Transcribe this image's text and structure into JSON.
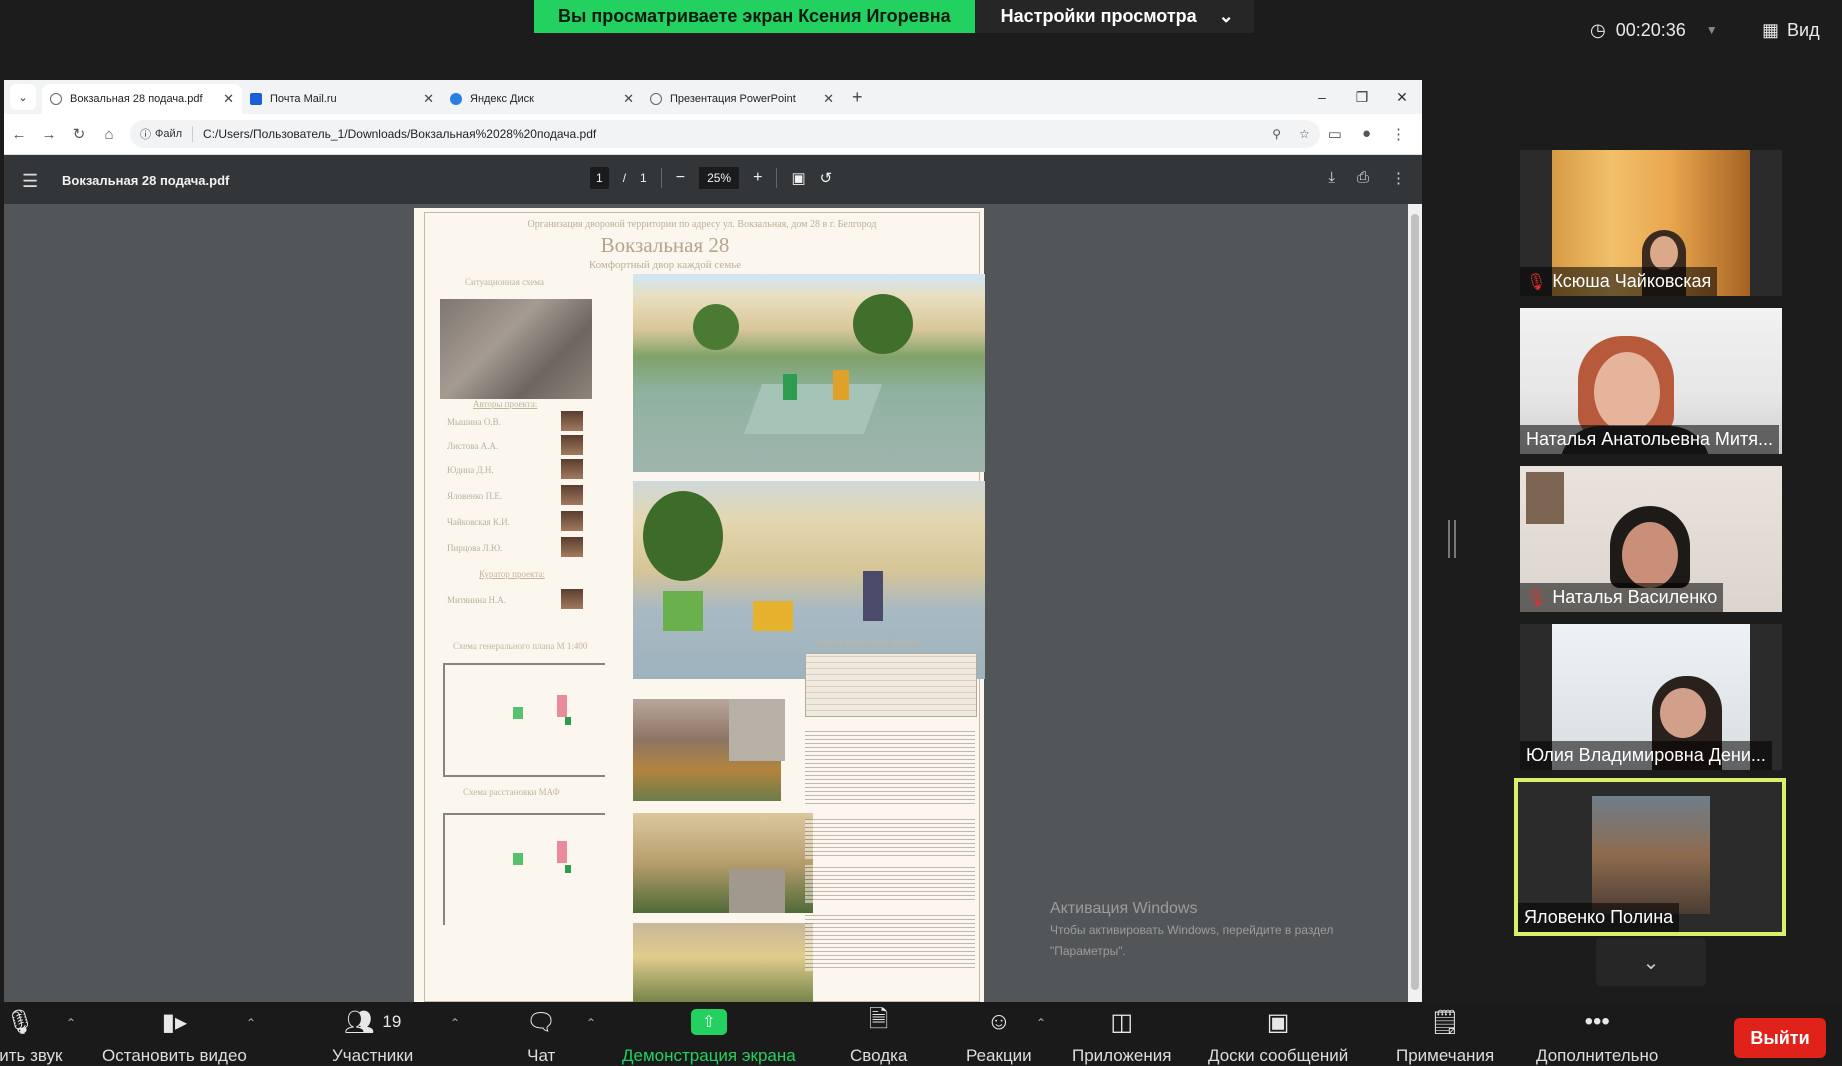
{
  "banner": {
    "sharing_text": "Вы просматриваете экран Ксения Игоревна",
    "view_settings_label": "Настройки просмотра"
  },
  "meeting": {
    "timer": "00:20:36",
    "view_label": "Вид"
  },
  "browser": {
    "tabs": [
      {
        "label": "Вокзальная 28 подача.pdf",
        "active": true
      },
      {
        "label": "Почта Mail.ru",
        "active": false
      },
      {
        "label": "Яндекс Диск",
        "active": false
      },
      {
        "label": "Презентация PowerPoint",
        "active": false
      }
    ],
    "address": {
      "chip_label": "Файл",
      "url": "C:/Users/Пользователь_1/Downloads/Вокзальная%2028%20подача.pdf"
    }
  },
  "pdf": {
    "file_title": "Вокзальная 28 подача.pdf",
    "current_page": "1",
    "page_separator": "/",
    "total_pages": "1",
    "zoom": "25%"
  },
  "poster": {
    "subtitle": "Организация дворовой территории по адресу ул. Вокзальная, дом 28 в г. Белгород",
    "title": "Вокзальная 28",
    "slogan": "Комфортный двор каждой семье",
    "situation_label": "Ситуационная схема",
    "authors_label": "Авторы проекта:",
    "authors": [
      "Мышина О.В.",
      "Листова А.А.",
      "Юдина Д.Н.",
      "Яловенко П.Е.",
      "Чайковская К.И.",
      "Пирцова Л.Ю."
    ],
    "curator_label": "Куратор проекта:",
    "curator": "Митянина Н.А.",
    "plan_label": "Схема генерального плана М 1:400",
    "maf_label": "Схема расстановки МАФ",
    "goals_label": "Цели и результаты проекта"
  },
  "watermark": {
    "title": "Активация Windows",
    "line1": "Чтобы активировать Windows, перейдите в раздел",
    "line2": "\"Параметры\"."
  },
  "participants": [
    {
      "name": "Ксюша Чайковская",
      "muted": true
    },
    {
      "name": "Наталья Анатольевна Митя...",
      "muted": false
    },
    {
      "name": "Наталья Василенко",
      "muted": true
    },
    {
      "name": "Юлия Владимировна Дени...",
      "muted": false
    },
    {
      "name": "Яловенко Полина",
      "muted": false,
      "speaking": true
    }
  ],
  "toolbar": {
    "mute_label": "ючить звук",
    "video_label": "Остановить видео",
    "participants_label": "Участники",
    "participants_count": "19",
    "chat_label": "Чат",
    "share_label": "Демонстрация экрана",
    "summary_label": "Сводка",
    "reactions_label": "Реакции",
    "apps_label": "Приложения",
    "boards_label": "Доски сообщений",
    "notes_label": "Примечания",
    "more_label": "Дополнительно",
    "leave_label": "Выйти"
  },
  "colors": {
    "share_green": "#23d160",
    "active_speaker": "#d8f06a",
    "leave_red": "#e0221a"
  }
}
